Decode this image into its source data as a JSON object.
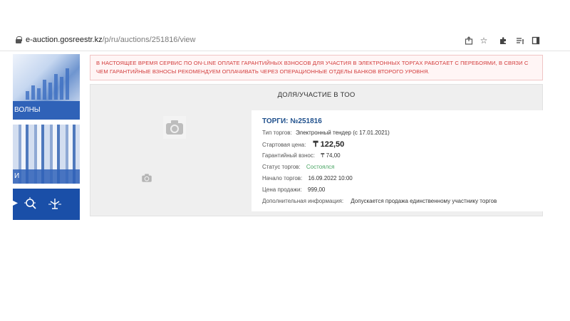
{
  "browser": {
    "url_host": "e-auction.gosreestr.kz",
    "url_path": "/p/ru/auctions/251816/view",
    "toolbar_icons": [
      "share-icon",
      "star-icon",
      "extension-icon",
      "reading-list-icon",
      "sidebar-icon"
    ]
  },
  "sidebar": {
    "thumb1_caption": "ВОЛНЫ",
    "thumb2_caption": "И"
  },
  "warning": {
    "text": "В НАСТОЯЩЕЕ ВРЕМЯ СЕРВИС ПО ON-LINE ОПЛАТЕ ГАРАНТИЙНЫХ ВЗНОСОВ ДЛЯ УЧАСТИЯ В ЭЛЕКТРОННЫХ ТОРГАХ РАБОТАЕТ С ПЕРЕБОЯМИ, В СВЯЗИ С ЧЕМ ГАРАНТИЙНЫЕ ВЗНОСЫ РЕКОМЕНДУЕМ ОПЛАЧИВАТЬ ЧЕРЕЗ ОПЕРАЦИОННЫЕ ОТДЕЛЫ БАНКОВ ВТОРОГО УРОВНЯ."
  },
  "panel": {
    "title": "ДОЛЯ/УЧАСТИЕ В ТОО"
  },
  "lot": {
    "title": "ТОРГИ: №251816",
    "type_label": "Тип торгов:",
    "type_value": "Электронный тендер (с 17.01.2021)",
    "start_price_label": "Стартовая цена:",
    "start_price_value": "₸ 122,50",
    "guarantee_label": "Гарантийный взнос:",
    "guarantee_value": "₸ 74,00",
    "status_label": "Статус торгов:",
    "status_value": "Состоялся",
    "start_label": "Начало торгов:",
    "start_value": "16.09.2022 10:00",
    "sale_label": "Цена продажи:",
    "sale_value": "999,00",
    "info_label": "Дополнительная информация:",
    "info_value": "Допускается продажа единственному участнику торгов"
  },
  "colors": {
    "warning_red": "#d23b3b",
    "lot_blue": "#1e4f8c",
    "status_green": "#4aa564"
  }
}
